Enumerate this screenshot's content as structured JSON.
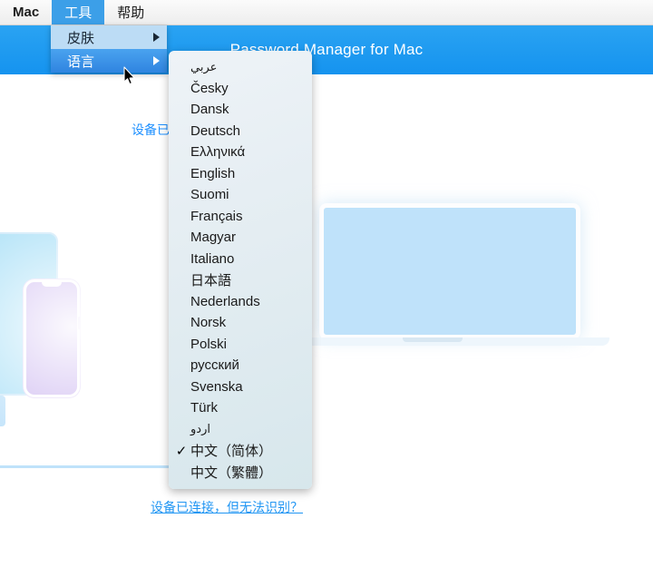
{
  "app": {
    "hero_title": "Password Manager for Mac",
    "status_text": "设备已连接",
    "help_link": "设备已连接，但无法识别？"
  },
  "menubar": {
    "items": [
      {
        "label": "Mac",
        "active": false
      },
      {
        "label": "工具",
        "active": true
      },
      {
        "label": "帮助",
        "active": false
      }
    ]
  },
  "tools_menu": {
    "items": [
      {
        "label": "皮肤",
        "has_submenu": true,
        "selected": false
      },
      {
        "label": "语言",
        "has_submenu": true,
        "selected": true
      }
    ],
    "submenu_arrow_icon": "triangle-right-icon"
  },
  "language_submenu": {
    "check_glyph": "✓",
    "items": [
      {
        "label": "عربي",
        "checked": false,
        "script": "rtl"
      },
      {
        "label": "Česky",
        "checked": false,
        "script": "latin"
      },
      {
        "label": "Dansk",
        "checked": false,
        "script": "latin"
      },
      {
        "label": "Deutsch",
        "checked": false,
        "script": "latin"
      },
      {
        "label": "Ελληνικά",
        "checked": false,
        "script": "latin"
      },
      {
        "label": "English",
        "checked": false,
        "script": "latin"
      },
      {
        "label": "Suomi",
        "checked": false,
        "script": "latin"
      },
      {
        "label": "Français",
        "checked": false,
        "script": "latin"
      },
      {
        "label": "Magyar",
        "checked": false,
        "script": "latin"
      },
      {
        "label": "Italiano",
        "checked": false,
        "script": "latin"
      },
      {
        "label": "日本語",
        "checked": false,
        "script": "cjk"
      },
      {
        "label": "Nederlands",
        "checked": false,
        "script": "latin"
      },
      {
        "label": "Norsk",
        "checked": false,
        "script": "latin"
      },
      {
        "label": "Polski",
        "checked": false,
        "script": "latin"
      },
      {
        "label": "русский",
        "checked": false,
        "script": "latin"
      },
      {
        "label": "Svenska",
        "checked": false,
        "script": "latin"
      },
      {
        "label": "Türk",
        "checked": false,
        "script": "latin"
      },
      {
        "label": "اردو",
        "checked": false,
        "script": "rtl"
      },
      {
        "label": "中文（简体）",
        "checked": true,
        "script": "cjk"
      },
      {
        "label": "中文（繁體）",
        "checked": false,
        "script": "cjk"
      }
    ]
  },
  "illustration": {
    "tablet_name": "tablet-illustration",
    "phone_name": "phone-illustration",
    "laptop_name": "laptop-illustration"
  },
  "colors": {
    "accent_blue": "#1e9bf0",
    "menu_highlight": "#3c9fe8",
    "menu_row_plain": "#bcdcf5",
    "link_blue": "#2196f3",
    "laptop_screen": "#bfe2fa",
    "phone_body": "#cdb8f0",
    "tablet_body": "#ade1f7"
  }
}
